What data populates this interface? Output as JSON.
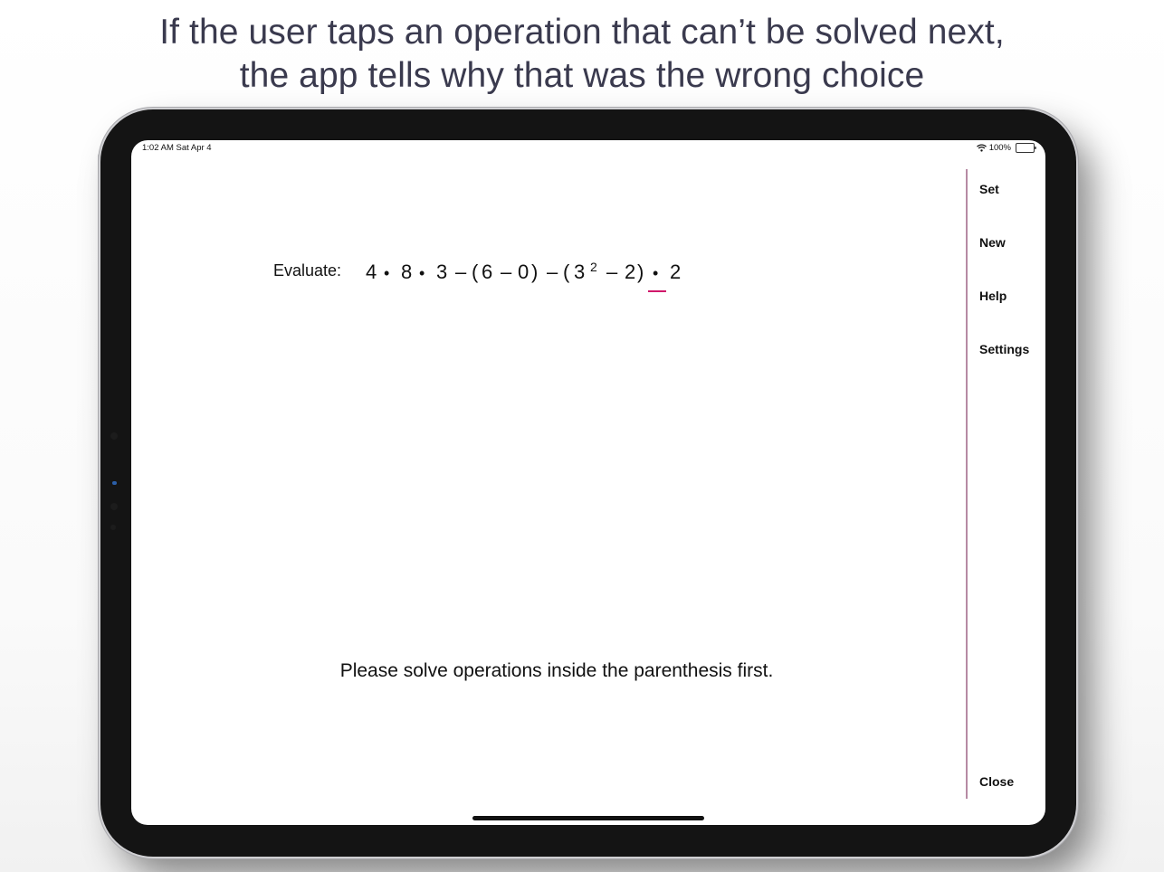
{
  "caption": {
    "line1": "If the user taps an operation that can’t be solved next,",
    "line2": "the app tells why that was the wrong choice"
  },
  "status_bar": {
    "time_date": "1:02 AM   Sat Apr 4",
    "wifi_icon": "wifi-icon",
    "battery_text": "100%",
    "battery_icon": "battery-icon",
    "battery_level": 1.0
  },
  "problem": {
    "label": "Evaluate:",
    "expression_tokens": [
      "4",
      "•",
      "8",
      "•",
      "3",
      "–",
      "(",
      "6",
      "–",
      "0",
      ")",
      "–",
      "(",
      "3",
      "2",
      "–",
      "2",
      ")",
      "•",
      "2"
    ],
    "selected_token_index": 18,
    "accent_color": "#d0176a"
  },
  "feedback": {
    "message": "Please solve operations inside the parenthesis first."
  },
  "sidebar": {
    "items": [
      {
        "label": "Set"
      },
      {
        "label": "New"
      },
      {
        "label": "Help"
      },
      {
        "label": "Settings"
      }
    ],
    "close_label": "Close"
  }
}
